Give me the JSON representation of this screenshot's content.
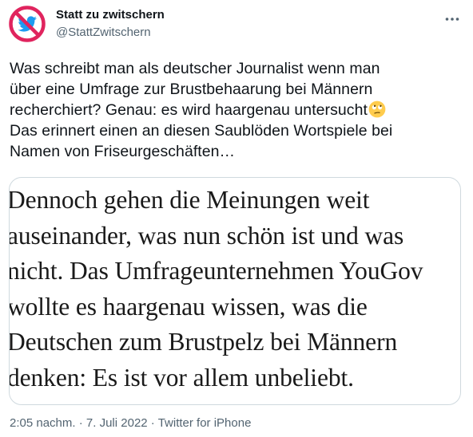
{
  "author": {
    "display_name": "Statt zu zwitschern",
    "handle": "@StattZwitschern",
    "avatar_icon": "no-twitter-bird-icon"
  },
  "more_icon": "more-dots-icon",
  "tweet": {
    "lines": [
      "Was schreibt man als deutscher Journalist wenn man",
      "über eine Umfrage zur Brustbehaarung bei Männern",
      "recherchiert? Genau: es wird haargenau untersucht",
      "Das erinnert einen an diesen Saublöden Wortspiele bei",
      "Namen von Friseurgeschäften…"
    ],
    "emoji": "eye-roll-emoji-icon"
  },
  "media": {
    "lines": [
      "Dennoch gehen die Meinungen weit",
      "auseinander, was nun schön ist und was",
      "nicht. Das Umfrageunternehmen YouGov",
      "wollte es haargenau wissen, was die",
      "Deutschen zum Brustpelz bei Männern",
      "denken: Es ist vor allem unbeliebt."
    ]
  },
  "meta": {
    "time": "2:05 nachm.",
    "separator": " · ",
    "date": "7. Juli 2022",
    "source": "Twitter for iPhone"
  },
  "colors": {
    "text": "#0f1419",
    "secondary": "#536471",
    "twitter_blue": "#1d9bf0",
    "no_sign_red": "#e0245e",
    "border": "#cfd9de"
  }
}
